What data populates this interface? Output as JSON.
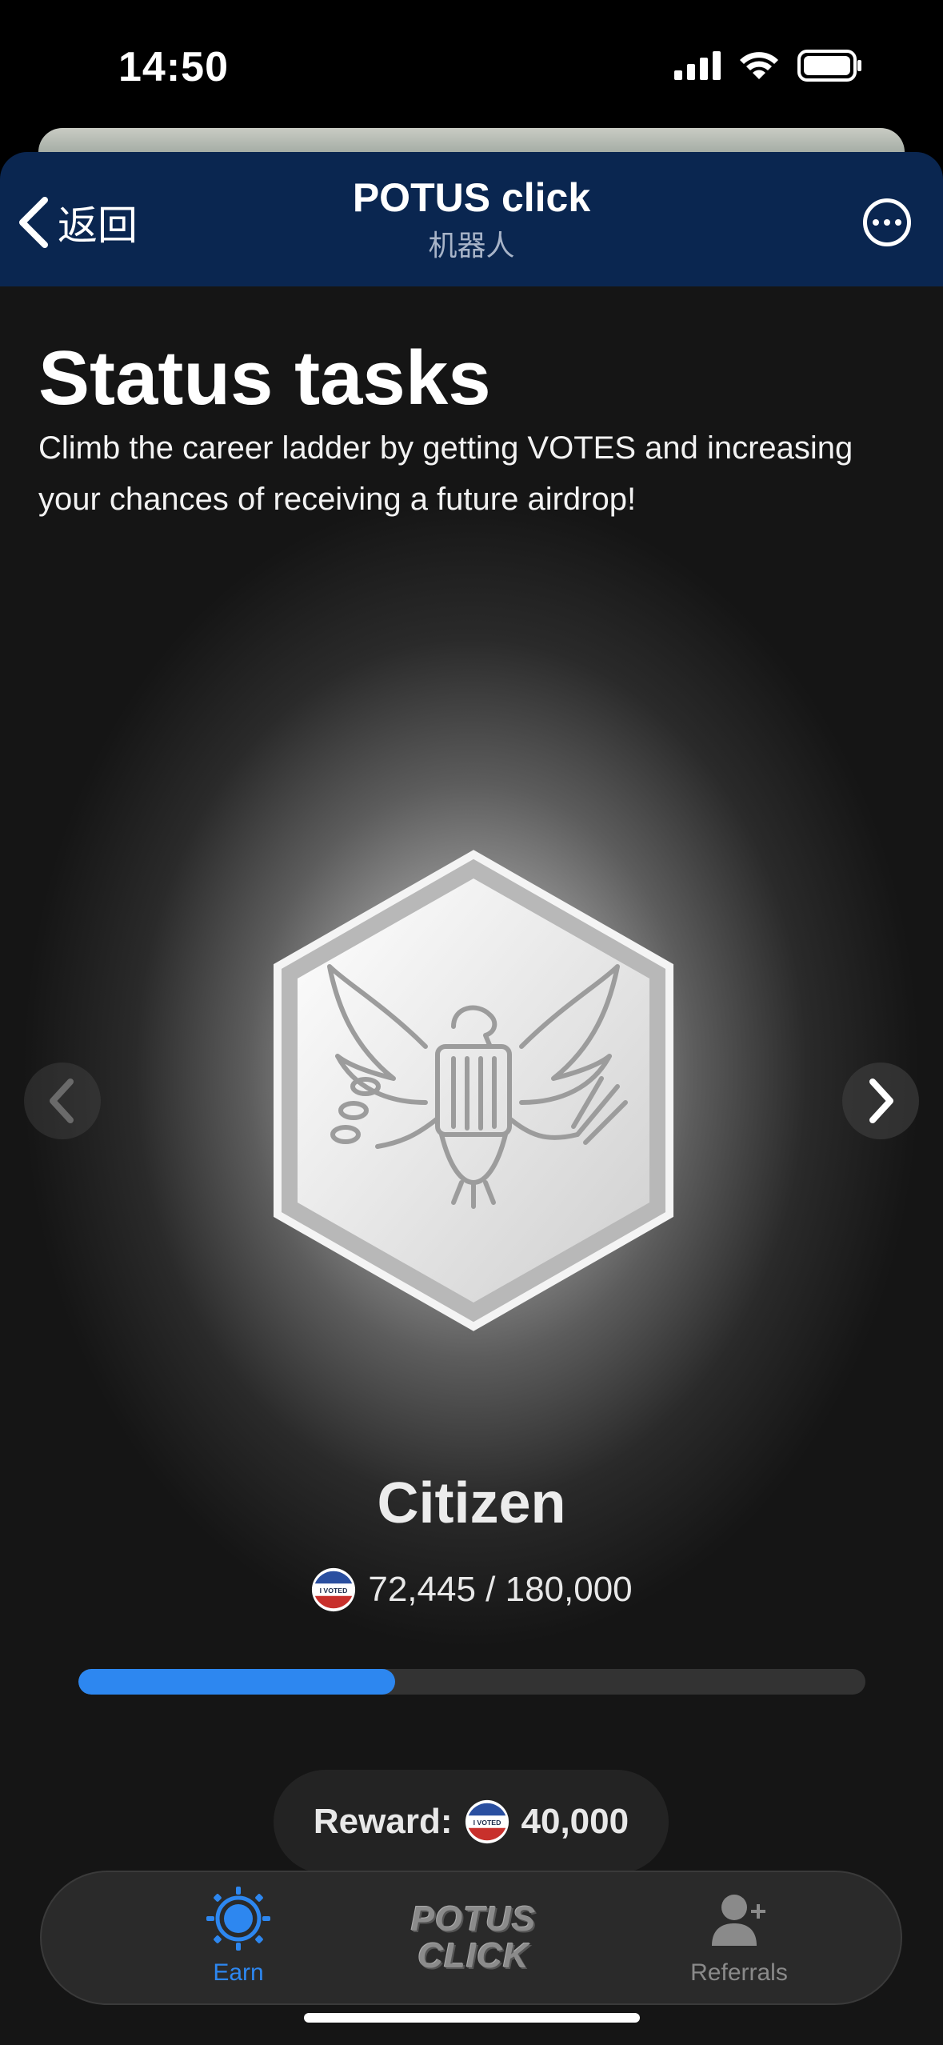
{
  "status_bar": {
    "time": "14:50"
  },
  "header": {
    "back_label": "返回",
    "title": "POTUS click",
    "subtitle": "机器人"
  },
  "page": {
    "heading": "Status tasks",
    "description": "Climb the career ladder by getting VOTES and increasing your chances of receiving a future airdrop!"
  },
  "status": {
    "rank_name": "Citizen",
    "progress_text": "72,445 / 180,000",
    "progress_current": 72445,
    "progress_target": 180000,
    "reward_label": "Reward:",
    "reward_value": "40,000",
    "coin_text": "I VOTED"
  },
  "tabs": [
    {
      "label": "Earn",
      "active": true
    },
    {
      "label": "Referrals",
      "active": false
    }
  ],
  "logo_text": {
    "line1": "POTUS",
    "line2": "CLICK"
  },
  "colors": {
    "accent": "#2d87f0",
    "header_bg": "#0a2650",
    "progress_track": "#333333"
  }
}
